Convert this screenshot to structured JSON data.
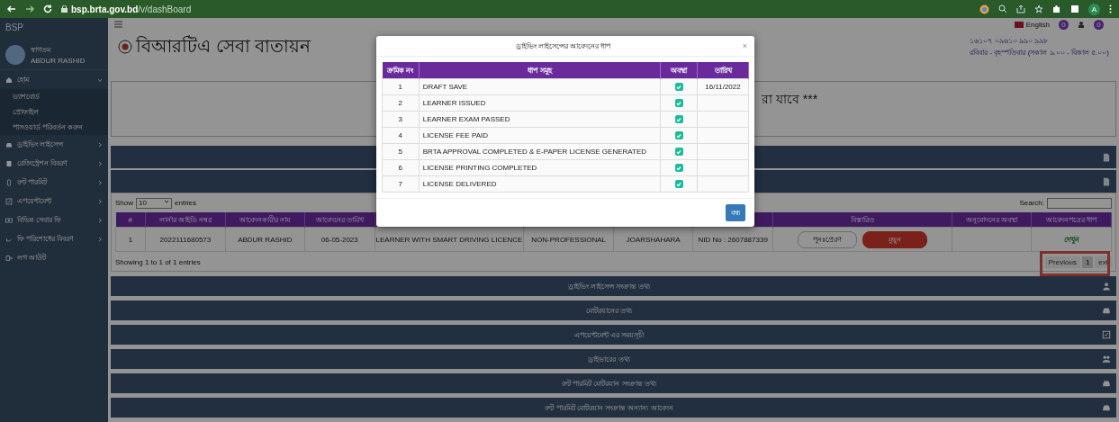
{
  "browser": {
    "url_host": "bsp.brta.gov.bd",
    "url_path": "/v/dashBoard",
    "profile": "A"
  },
  "sidebar": {
    "brand": "BSP",
    "greeting": "স্বাগতম",
    "user": "ABDUR RASHID",
    "items": [
      {
        "label": "হোম",
        "expanded": true,
        "children": [
          "ড্যাশবোর্ড",
          "প্রোফাইল",
          "পাসওয়ার্ড পরিবর্তন করুন"
        ]
      },
      {
        "label": "ড্রাইভিং লাইসেন্স",
        "expanded": false
      },
      {
        "label": "রেজিস্ট্রেশন বিবরণ",
        "expanded": false
      },
      {
        "label": "রুট পারমিট",
        "expanded": false
      },
      {
        "label": "এপয়েন্টমেন্ট",
        "expanded": false
      },
      {
        "label": "বিভিন্ন সেবার ফি",
        "expanded": false
      },
      {
        "label": "ফি পরিশোধের বিবরণ",
        "expanded": false
      },
      {
        "label": "লগ আউট"
      }
    ]
  },
  "topbar": {
    "language": "English",
    "notification_count": "0",
    "message_count": "0"
  },
  "header": {
    "title": "বিআরটিএ সেবা বাতায়ন",
    "hotline": "১৬১০৭ ০৯৬১০ ৯৯০ ৯৯৮",
    "hours": "রবিবার - বৃহস্পতিবার (সকাল ৯.০০ - বিকাল ৫.০০)"
  },
  "notice": "রা যাবে ***",
  "applications": {
    "show_label": "Show",
    "page_size": "10",
    "entries_label": "entries",
    "search_label": "Search:",
    "columns": [
      "#",
      "লার্নার আইডি নম্বর",
      "আবেদনকারীর নাম",
      "আবেদনের তারিখ",
      null,
      null,
      null,
      null,
      "বিস্তারিত",
      "অনুমোদনের অবস্থা",
      "আবেদনপত্রের ধাপ"
    ],
    "rows": [
      {
        "cells": [
          "1",
          "2022111680573",
          "ABDUR RASHID",
          "06-05-2023",
          "LEARNER WITH SMART DRIVING LICENCE",
          "NON-PROFESSIONAL",
          "JOARSHAHARA",
          "NID No : 2607887339"
        ],
        "actions": [
          "পুনঃপ্রেরণ",
          "মুছুন"
        ],
        "step_link": "দেখুন"
      }
    ],
    "info": "Showing 1 to 1 of 1 entries",
    "pagination": {
      "previous": "Previous",
      "pages": [
        {
          "label": "1",
          "selected": true
        }
      ],
      "next": "ext"
    }
  },
  "sections": [
    "ড্রাইভিং লাইসেন্স সংক্রান্ত তথ্য",
    "মোটরযানের তথ্য",
    "এপয়েন্টমেন্ট এর সময়সূচী",
    "ড্রাইভারের তথ্য",
    "রুট পারমিট মোটরযান সংক্রান্ত তথ্য",
    "রুট পারমিট মোটরযান সংক্রান্ত অন্যান্য আবেদন"
  ],
  "modal": {
    "title": "ড্রাইভিং লাইসেন্সের আবেদনের ধাপ",
    "close_symbol": "×",
    "columns": [
      "ক্রমিক নং",
      "ধাপ সমূহ",
      "অবস্থা",
      "তারিখ"
    ],
    "steps": [
      {
        "no": "1",
        "name": "DRAFT SAVE",
        "done": true,
        "date": "16/11/2022"
      },
      {
        "no": "2",
        "name": "LEARNER ISSUED",
        "done": true
      },
      {
        "no": "3",
        "name": "LEARNER EXAM PASSED",
        "done": true
      },
      {
        "no": "4",
        "name": "LICENSE FEE PAID",
        "done": true
      },
      {
        "no": "5",
        "name": "BRTA APPROVAL COMPLETED & E-PAPER LICENSE GENERATED",
        "done": true
      },
      {
        "no": "6",
        "name": "LICENSE PRINTING COMPLETED",
        "done": true
      },
      {
        "no": "7",
        "name": "LICENSE DELIVERED",
        "done": true
      }
    ],
    "close_button": "বন্ধ"
  }
}
